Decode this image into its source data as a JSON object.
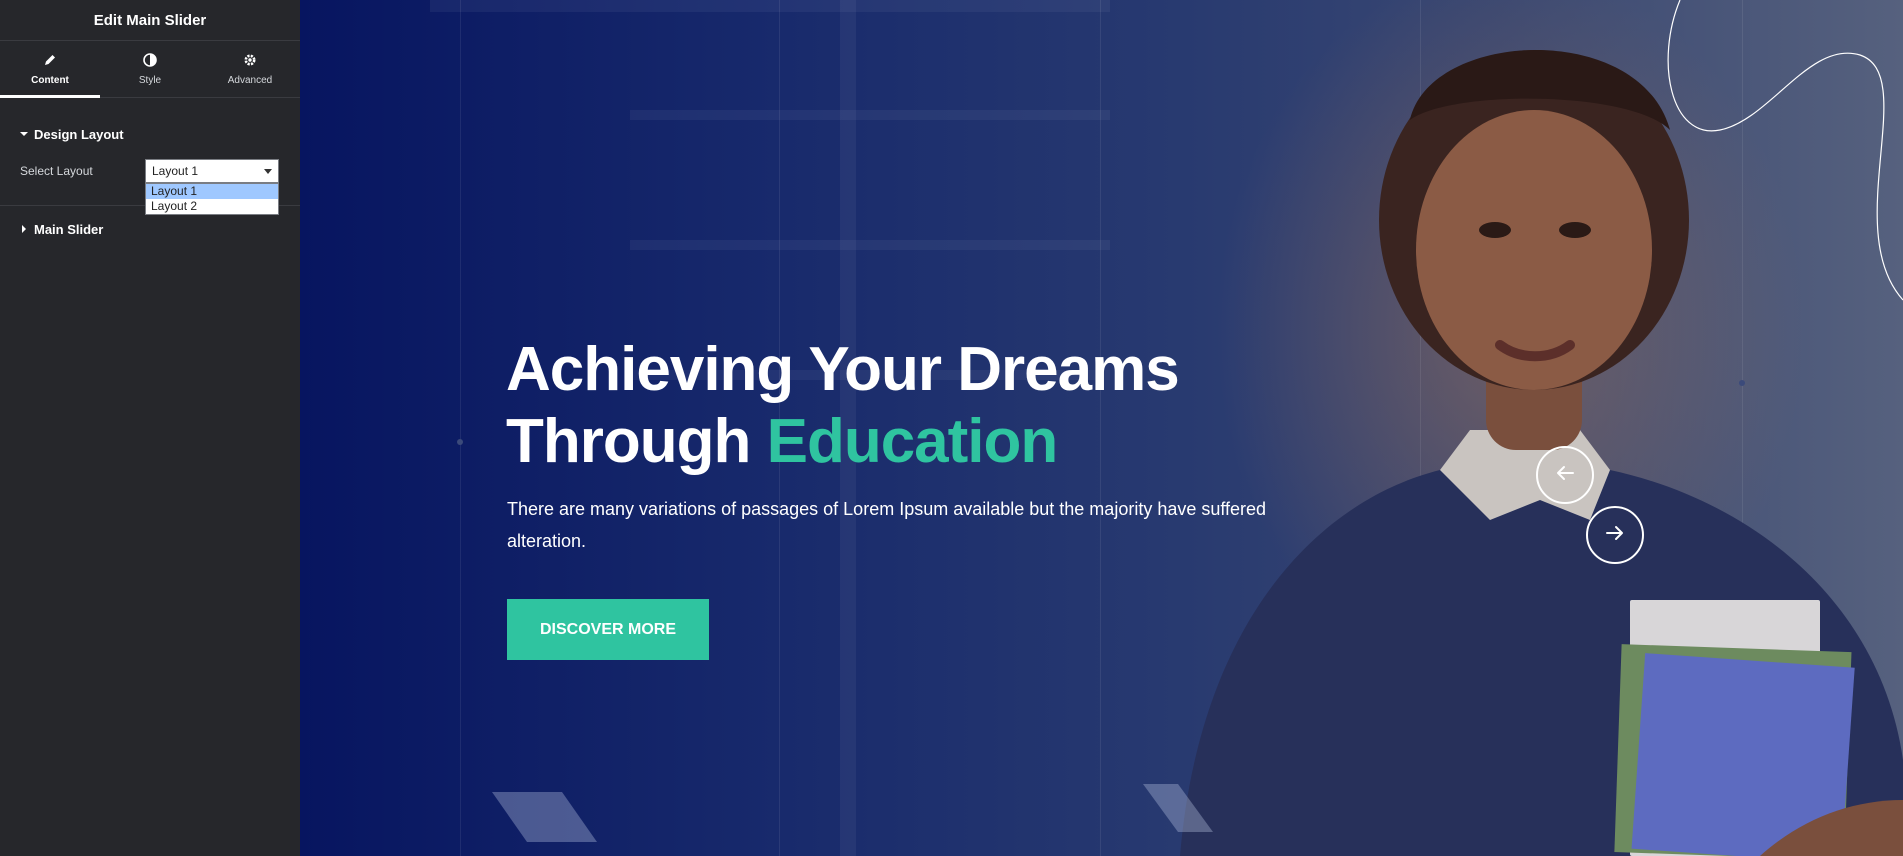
{
  "editor": {
    "title": "Edit Main Slider",
    "tabs": [
      {
        "label": "Content",
        "icon": "pencil-icon"
      },
      {
        "label": "Style",
        "icon": "half-circle-icon"
      },
      {
        "label": "Advanced",
        "icon": "gear-icon"
      }
    ],
    "sections": {
      "design_layout": "Design Layout",
      "main_slider": "Main Slider"
    },
    "select_layout": {
      "label": "Select Layout",
      "value": "Layout 1",
      "options": [
        "Layout 1",
        "Layout 2"
      ]
    }
  },
  "hero": {
    "heading_line1": "Achieving Your Dreams",
    "heading_line2_plain": "Through ",
    "heading_line2_accent": "Education",
    "subtext": "There are many variations of passages of Lorem Ipsum available but the majority have suffered alteration.",
    "button_label": "DISCOVER MORE",
    "prev_icon": "arrow-left-icon",
    "next_icon": "arrow-right-icon"
  },
  "colors": {
    "panel_bg": "#26272b",
    "accent": "#2fc4a0",
    "hero_bg": "#0b1a5c",
    "selected_option": "#9fc8ff"
  }
}
